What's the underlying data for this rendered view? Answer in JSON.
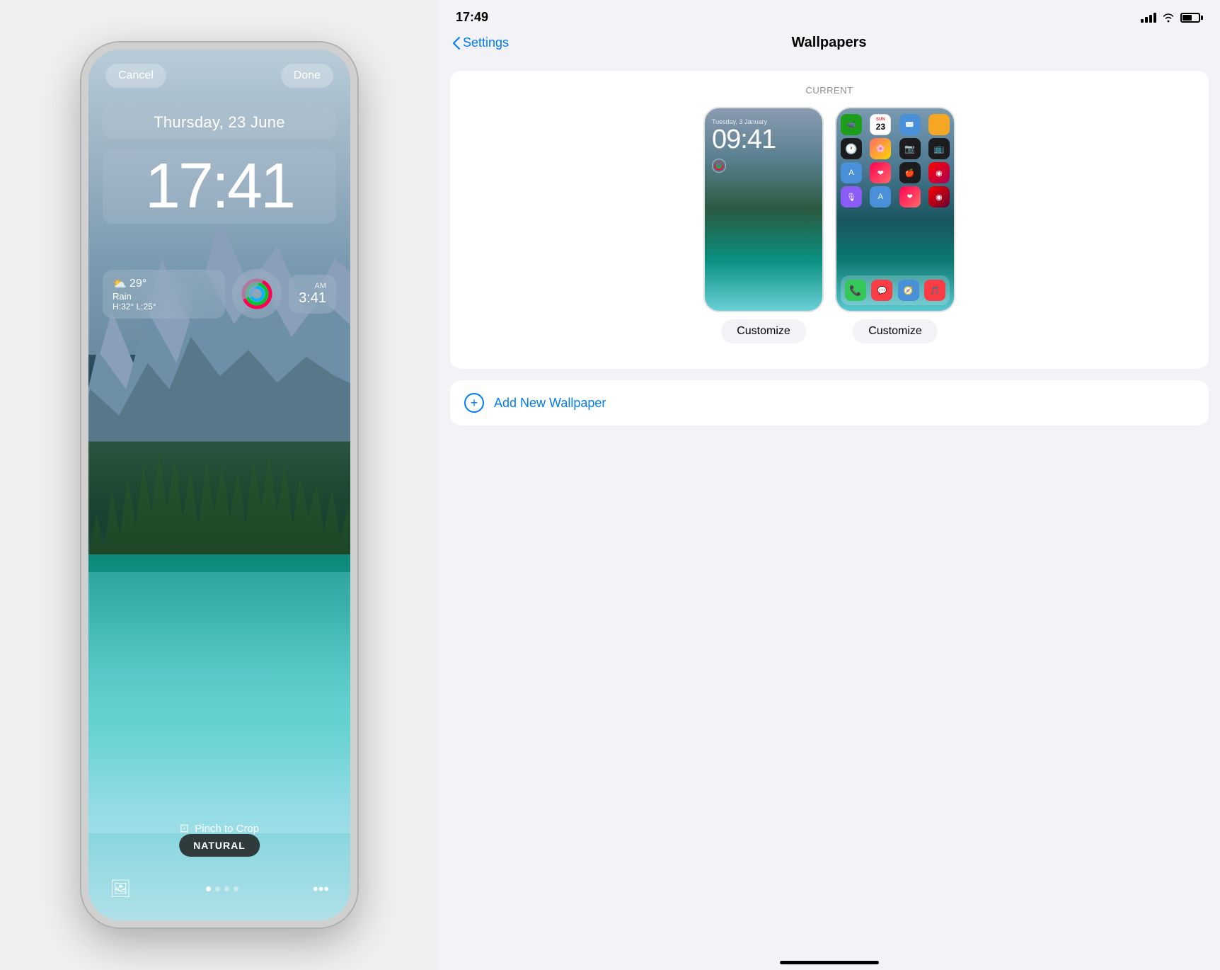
{
  "left": {
    "cancel_label": "Cancel",
    "done_label": "Done",
    "date_text": "Thursday, 23 June",
    "time_text": "17:41",
    "weather_temp": "29°",
    "weather_condition": "Rain",
    "weather_hi_lo": "H:32° L:25°",
    "widget_time": "3:41",
    "widget_time_label": "AM",
    "pinch_crop": "Pinch to Crop",
    "natural_badge": "NATURAL",
    "dot_count": 4,
    "active_dot": 0
  },
  "right": {
    "status_time": "17:49",
    "nav_back_label": "Settings",
    "nav_title": "Wallpapers",
    "current_label": "CURRENT",
    "lock_screen_time": "09:41",
    "lock_screen_date": "Tuesday, 3 January",
    "customize_label": "Customize",
    "add_wallpaper_label": "Add New Wallpaper"
  }
}
